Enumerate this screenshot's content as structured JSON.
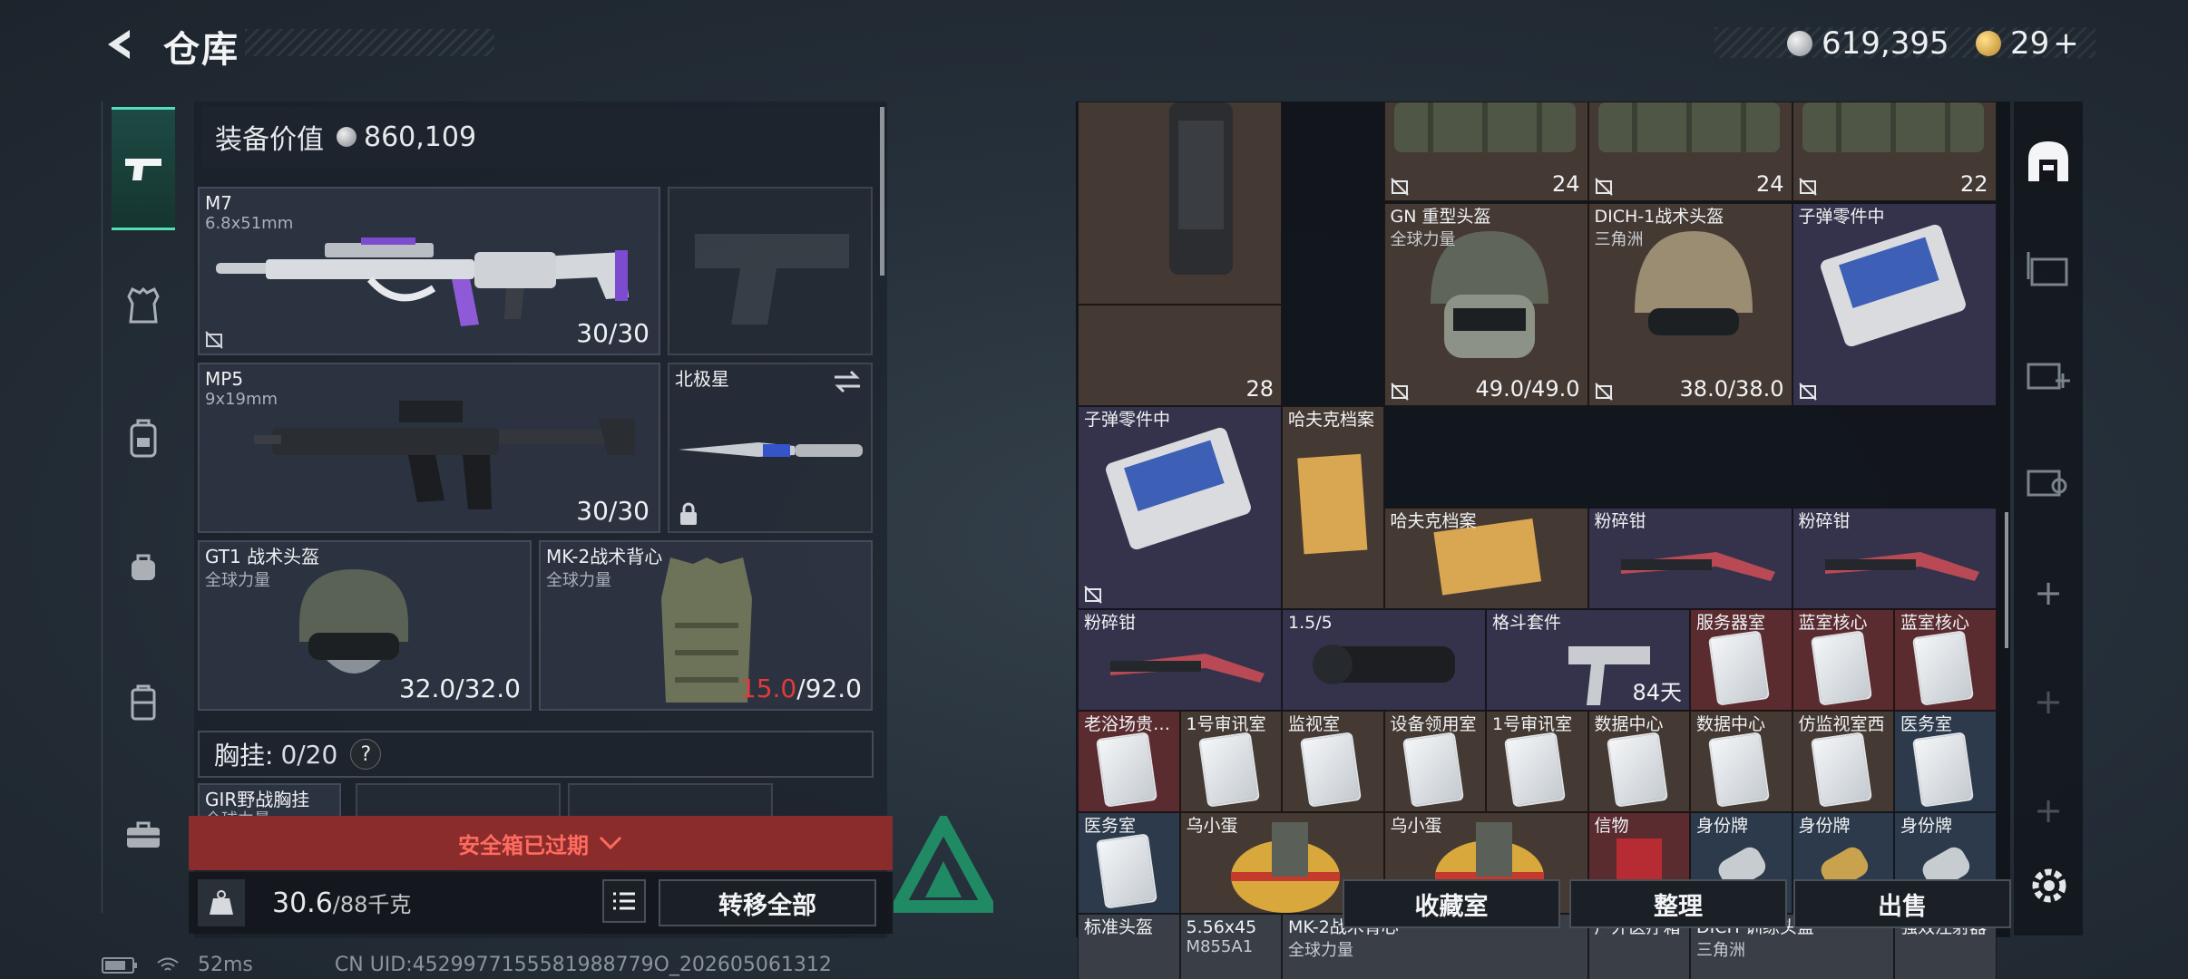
{
  "header": {
    "title": "仓库",
    "currency1": "619,395",
    "currency2": "29",
    "currency2_plus": "+"
  },
  "equipment": {
    "value_label": "装备价值",
    "value": "860,109",
    "primary": {
      "name": "M7",
      "caliber": "6.8x51mm",
      "ammo": "30/30"
    },
    "secondary": {
      "name": "MP5",
      "caliber": "9x19mm",
      "ammo": "30/30"
    },
    "melee": {
      "name": "北极星"
    },
    "helmet": {
      "name": "GT1 战术头盔",
      "brand": "全球力量",
      "durability": "32.0/32.0"
    },
    "armor": {
      "name": "MK-2战术背心",
      "brand": "全球力量",
      "durability_cur": "15.0",
      "durability_max": "/92.0"
    },
    "chest_label": "胸挂:",
    "chest_value": "0/20",
    "chest_help": "?",
    "rig": {
      "name": "GIR野战胸挂",
      "brand": "全球力量"
    },
    "safe_expired": "安全箱已过期",
    "weight": "30.6",
    "weight_max": "/88千克",
    "transfer_all": "转移全部"
  },
  "status": {
    "ping": "52ms",
    "uid": "CN UID:4529977155581988779O_202605061312"
  },
  "stash": {
    "cells": [
      {
        "label": "",
        "count": ""
      },
      {
        "label": "",
        "count": "24"
      },
      {
        "label": "",
        "count": "24"
      },
      {
        "label": "",
        "count": "22"
      },
      {
        "label": "",
        "count": "28"
      },
      {
        "label": "GN 重型头盔",
        "sub": "全球力量",
        "count": "49.0/49.0"
      },
      {
        "label": "DICH-1战术头盔",
        "sub": "三角洲",
        "count": "38.0/38.0"
      },
      {
        "label": "子弹零件中",
        "count": ""
      },
      {
        "label": "子弹零件中",
        "count": ""
      },
      {
        "label": "哈夫克档案",
        "count": ""
      },
      {
        "label": "哈夫克档案",
        "count": ""
      },
      {
        "label": "粉碎钳",
        "count": ""
      },
      {
        "label": "粉碎钳",
        "count": ""
      },
      {
        "label": "粉碎钳",
        "count": ""
      },
      {
        "label": "1.5/5",
        "count": ""
      },
      {
        "label": "格斗套件",
        "count": "84天"
      },
      {
        "label": "服务器室",
        "count": ""
      },
      {
        "label": "蓝室核心",
        "count": ""
      },
      {
        "label": "蓝室核心",
        "count": ""
      },
      {
        "label": "老浴场贵…",
        "count": ""
      },
      {
        "label": "1号审讯室",
        "count": ""
      },
      {
        "label": "监视室",
        "count": ""
      },
      {
        "label": "设备领用室",
        "count": ""
      },
      {
        "label": "1号审讯室",
        "count": ""
      },
      {
        "label": "数据中心",
        "count": ""
      },
      {
        "label": "数据中心",
        "count": ""
      },
      {
        "label": "仿监视室西",
        "count": ""
      },
      {
        "label": "医务室",
        "count": ""
      },
      {
        "label": "医务室",
        "count": ""
      },
      {
        "label": "乌小蛋",
        "count": ""
      },
      {
        "label": "乌小蛋",
        "count": ""
      },
      {
        "label": "信物",
        "count": ""
      },
      {
        "label": "身份牌",
        "count": ""
      },
      {
        "label": "身份牌",
        "count": ""
      },
      {
        "label": "身份牌",
        "count": ""
      },
      {
        "label": "标准头盔",
        "count": ""
      },
      {
        "label": "5.56x45",
        "sub": "M855A1",
        "count": ""
      },
      {
        "label": "MK-2战术背心",
        "sub": "全球力量",
        "count": ""
      },
      {
        "label": "户外医疗箱",
        "count": ""
      },
      {
        "label": "DICH 训练头盔",
        "sub": "三角洲",
        "count": ""
      },
      {
        "label": "强效注射器",
        "count": ""
      }
    ],
    "buttons": {
      "collection": "收藏室",
      "organize": "整理",
      "sell": "出售"
    }
  },
  "rail_plus": "+",
  "colors": {
    "accent": "#4fe0b8",
    "danger": "#e23b3b",
    "expired_bg": "#8a2c2c"
  }
}
